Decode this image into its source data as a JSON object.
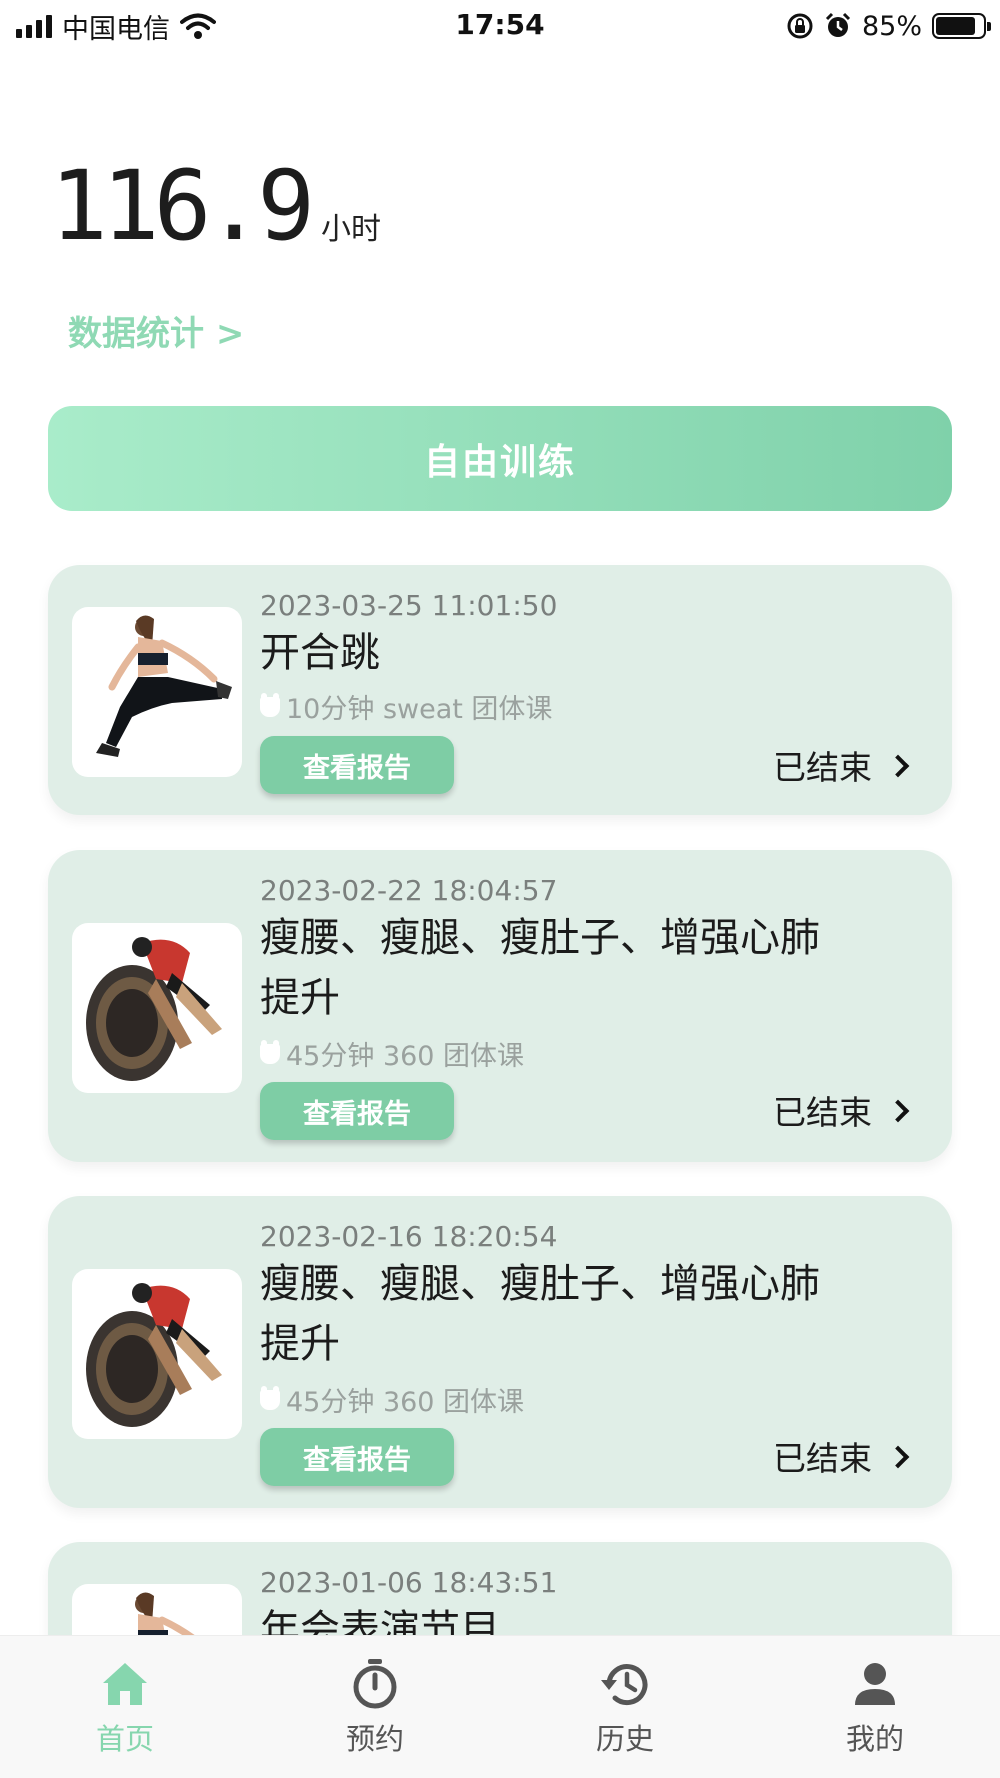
{
  "status_bar": {
    "carrier": "中国电信",
    "time": "17:54",
    "battery_percent": "85%",
    "battery_level": 0.85
  },
  "hero": {
    "hours_value": "116.9",
    "hours_unit": "小时",
    "stats_link": "数据统计 >"
  },
  "free_training_label": "自由训练",
  "cards": [
    {
      "date": "2023-03-25 11:01:50",
      "title": " 开合跳",
      "meta": "10分钟 sweat 团体课",
      "button": "查看报告",
      "status": "已结束",
      "thumb": "woman-stretching"
    },
    {
      "date": "2023-02-22 18:04:57",
      "title": " 瘦腰、瘦腿、瘦肚子、增强心肺提升",
      "meta": "45分钟 360 团体课",
      "button": "查看报告",
      "status": "已结束",
      "thumb": "cyclist"
    },
    {
      "date": "2023-02-16 18:20:54",
      "title": " 瘦腰、瘦腿、瘦肚子、增强心肺提升",
      "meta": "45分钟 360 团体课",
      "button": "查看报告",
      "status": "已结束",
      "thumb": "cyclist"
    },
    {
      "date": "2023-01-06 18:43:51",
      "title": " 年会表演节目",
      "thumb": "woman-stretching"
    }
  ],
  "tabs": [
    {
      "label": "首页",
      "icon": "home-icon",
      "active": true
    },
    {
      "label": "预约",
      "icon": "stopwatch-icon",
      "active": false
    },
    {
      "label": "历史",
      "icon": "history-icon",
      "active": false
    },
    {
      "label": "我的",
      "icon": "person-icon",
      "active": false
    }
  ],
  "colors": {
    "accent": "#7ecda5",
    "accent_light": "#a9ecca",
    "card_bg": "#e0eee7",
    "tab_active": "#86d6ae"
  }
}
